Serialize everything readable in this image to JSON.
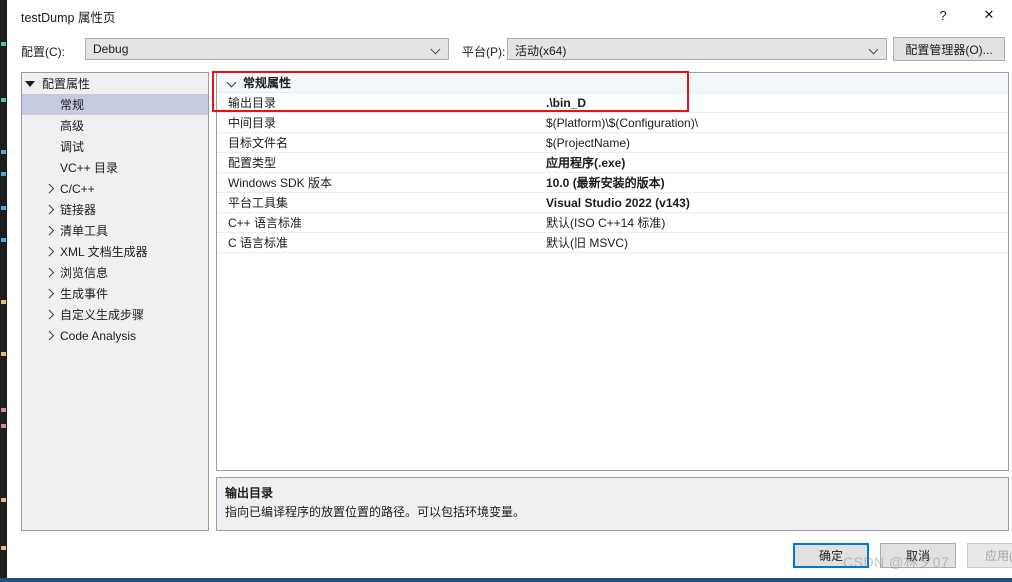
{
  "window": {
    "title": "testDump 属性页",
    "help_icon": "?",
    "close_icon": "✕"
  },
  "configbar": {
    "config_label": "配置(C):",
    "config_value": "Debug",
    "platform_label": "平台(P):",
    "platform_value": "活动(x64)",
    "config_manager_button": "配置管理器(O)..."
  },
  "sidebar": {
    "items": [
      {
        "label": "配置属性",
        "indent": 0,
        "expander": "down",
        "selected": false
      },
      {
        "label": "常规",
        "indent": 1,
        "expander": "none",
        "selected": true
      },
      {
        "label": "高级",
        "indent": 1,
        "expander": "none",
        "selected": false
      },
      {
        "label": "调试",
        "indent": 1,
        "expander": "none",
        "selected": false
      },
      {
        "label": "VC++ 目录",
        "indent": 1,
        "expander": "none",
        "selected": false
      },
      {
        "label": "C/C++",
        "indent": 1,
        "expander": "right",
        "selected": false
      },
      {
        "label": "链接器",
        "indent": 1,
        "expander": "right",
        "selected": false
      },
      {
        "label": "清单工具",
        "indent": 1,
        "expander": "right",
        "selected": false
      },
      {
        "label": "XML 文档生成器",
        "indent": 1,
        "expander": "right",
        "selected": false
      },
      {
        "label": "浏览信息",
        "indent": 1,
        "expander": "right",
        "selected": false
      },
      {
        "label": "生成事件",
        "indent": 1,
        "expander": "right",
        "selected": false
      },
      {
        "label": "自定义生成步骤",
        "indent": 1,
        "expander": "right",
        "selected": false
      },
      {
        "label": "Code Analysis",
        "indent": 1,
        "expander": "right",
        "selected": false
      }
    ]
  },
  "grid": {
    "rows": [
      {
        "name": "常规属性",
        "value": "",
        "category": true,
        "bold_value": false
      },
      {
        "name": "输出目录",
        "value": ".\\bin_D",
        "category": false,
        "bold_value": true
      },
      {
        "name": "中间目录",
        "value": "$(Platform)\\$(Configuration)\\",
        "category": false,
        "bold_value": false
      },
      {
        "name": "目标文件名",
        "value": "$(ProjectName)",
        "category": false,
        "bold_value": false
      },
      {
        "name": "配置类型",
        "value": "应用程序(.exe)",
        "category": false,
        "bold_value": true
      },
      {
        "name": "Windows SDK 版本",
        "value": "10.0 (最新安装的版本)",
        "category": false,
        "bold_value": true
      },
      {
        "name": "平台工具集",
        "value": "Visual Studio 2022 (v143)",
        "category": false,
        "bold_value": true
      },
      {
        "name": "C++ 语言标准",
        "value": "默认(ISO C++14 标准)",
        "category": false,
        "bold_value": false
      },
      {
        "name": "C 语言标准",
        "value": "默认(旧 MSVC)",
        "category": false,
        "bold_value": false
      }
    ]
  },
  "description": {
    "title": "输出目录",
    "body": "指向已编译程序的放置位置的路径。可以包括环境变量。"
  },
  "footer": {
    "ok": "确定",
    "cancel": "取消",
    "apply": "应用(A)"
  },
  "watermark": "CSDN @林夕07",
  "colors": {
    "accent": "#0078d7",
    "annotation": "#e8130f",
    "selection": "#c5cade"
  }
}
